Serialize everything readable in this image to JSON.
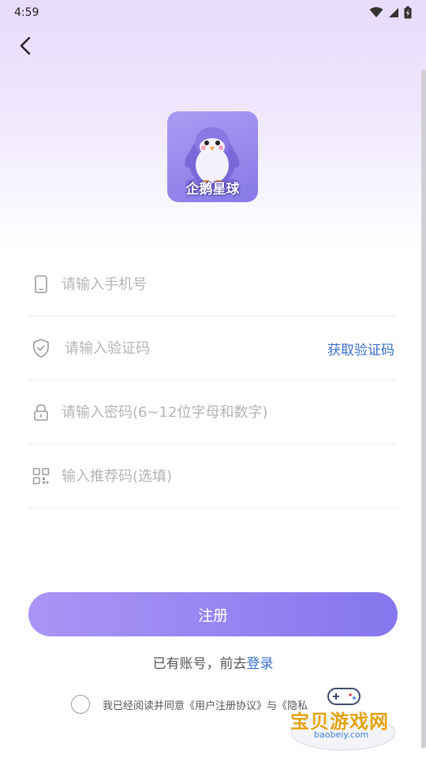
{
  "status": {
    "time": "4:59"
  },
  "app": {
    "logo_text": "企鹅星球"
  },
  "form": {
    "phone_placeholder": "请输入手机号",
    "code_placeholder": "请输入验证码",
    "get_code_label": "获取验证码",
    "password_placeholder": "请输入密码(6~12位字母和数字)",
    "referral_placeholder": "输入推荐码(选填)"
  },
  "register_label": "注册",
  "login_prompt": "已有账号，前去",
  "login_link": "登录",
  "agreement": "我已经阅读并同意《用户注册协议》与《隐私",
  "watermark": {
    "title": "宝贝游戏网",
    "url": "baobeiy.com"
  },
  "colors": {
    "accent": "#8576ee",
    "link": "#3a6fd0"
  },
  "icons": [
    "back-arrow-icon",
    "phone-icon",
    "shield-icon",
    "lock-icon",
    "qr-code-icon",
    "wifi-icon",
    "signal-icon",
    "battery-icon",
    "penguin-logo",
    "gamepad-icon"
  ]
}
